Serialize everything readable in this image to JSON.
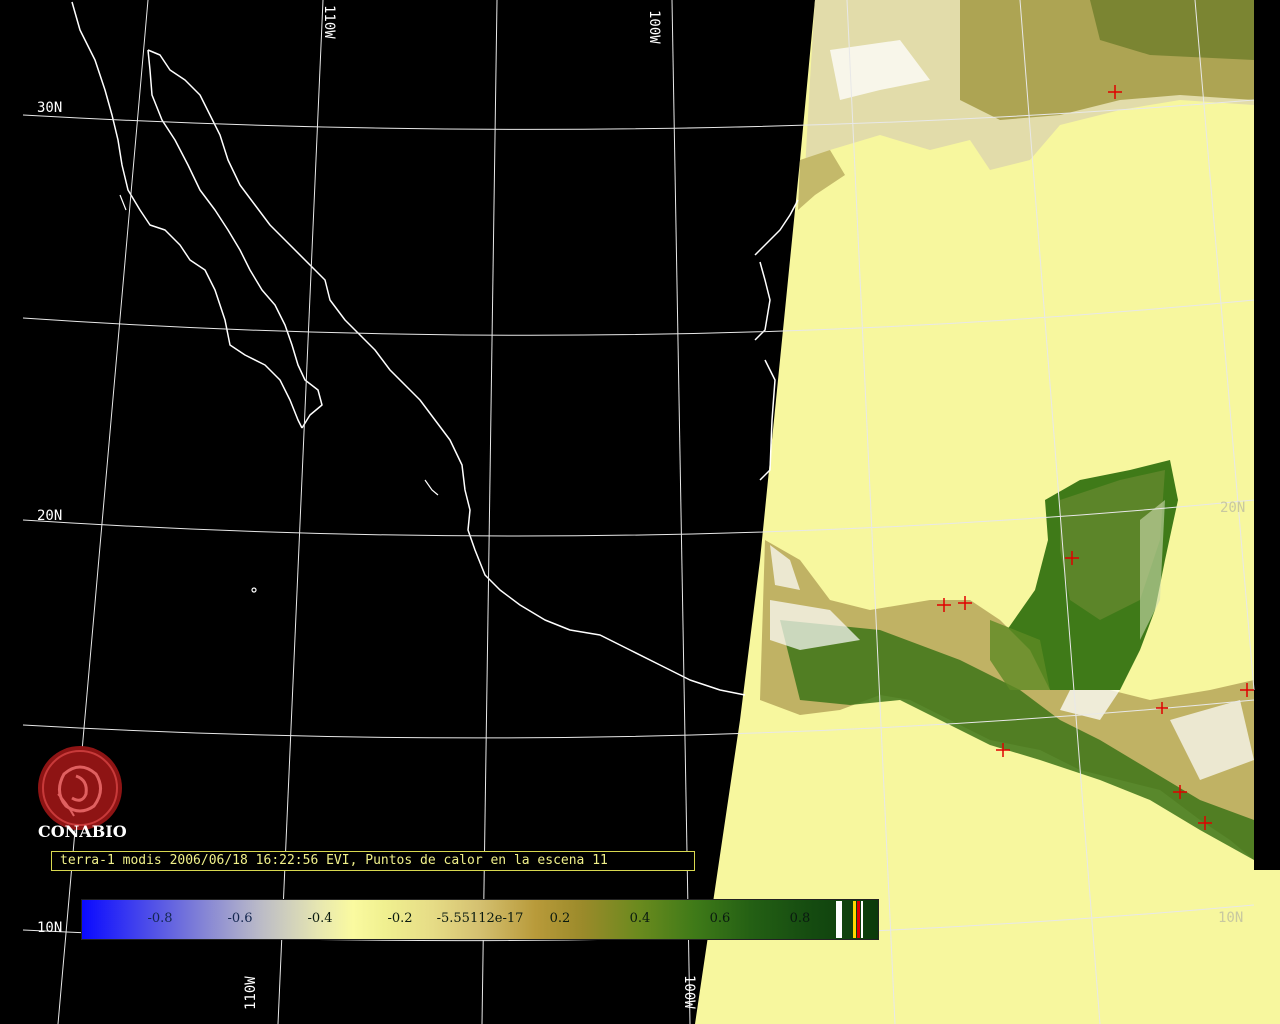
{
  "caption": "terra-1 modis 2006/06/18 16:22:56 EVI, Puntos de calor en la escena 11",
  "logo": {
    "name": "CONABIO",
    "icon": "conabio-logo-icon"
  },
  "grid": {
    "lat_labels": [
      "30N",
      "20N",
      "10N"
    ],
    "lon_labels": [
      "110W",
      "100W"
    ],
    "lat_labels_right": [
      "20N",
      "10N"
    ],
    "lon_label_bottom": "110W",
    "lon_label_bottom2": "100W"
  },
  "colorbar": {
    "ticks": [
      "-0.8",
      "-0.6",
      "-0.4",
      "-0.2",
      "-5.55112e-17",
      "0.2",
      "0.4",
      "0.6",
      "0.8"
    ],
    "colors": {
      "min": "#0a0aff",
      "mid": "#fafaa0",
      "max": "#0b3a0a",
      "fire": "#e00000"
    }
  },
  "colors": {
    "ocean_land_nodata": "#000000",
    "water_evi": "#fafaa0",
    "coast": "#ffffff",
    "fire_marker": "#e00000"
  }
}
